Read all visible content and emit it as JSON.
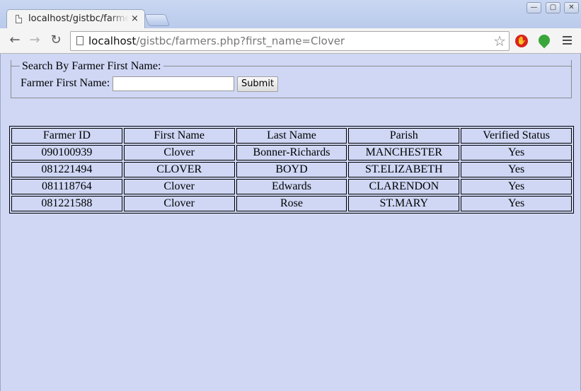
{
  "browser": {
    "tab_title": "localhost/gistbc/farmers.php?first_name=Clover",
    "tab_close": "×",
    "url_host": "localhost",
    "url_path": "/gistbc/farmers.php?first_name=Clover",
    "window_buttons": {
      "minimize": "—",
      "maximize": "▢",
      "close": "✕"
    },
    "nav": {
      "back": "←",
      "forward": "→",
      "reload": "↻"
    },
    "star": "☆"
  },
  "search_form": {
    "legend": "Search By Farmer First Name:",
    "label": "Farmer First Name:",
    "input_value": "",
    "submit_label": "Submit"
  },
  "table": {
    "headers": [
      "Farmer ID",
      "First Name",
      "Last Name",
      "Parish",
      "Verified Status"
    ],
    "rows": [
      [
        "090100939",
        "Clover",
        "Bonner-Richards",
        "MANCHESTER",
        "Yes"
      ],
      [
        "081221494",
        "CLOVER",
        "BOYD",
        "ST.ELIZABETH",
        "Yes"
      ],
      [
        "081118764",
        "Clover",
        "Edwards",
        "CLARENDON",
        "Yes"
      ],
      [
        "081221588",
        "Clover",
        "Rose",
        "ST.MARY",
        "Yes"
      ]
    ]
  }
}
